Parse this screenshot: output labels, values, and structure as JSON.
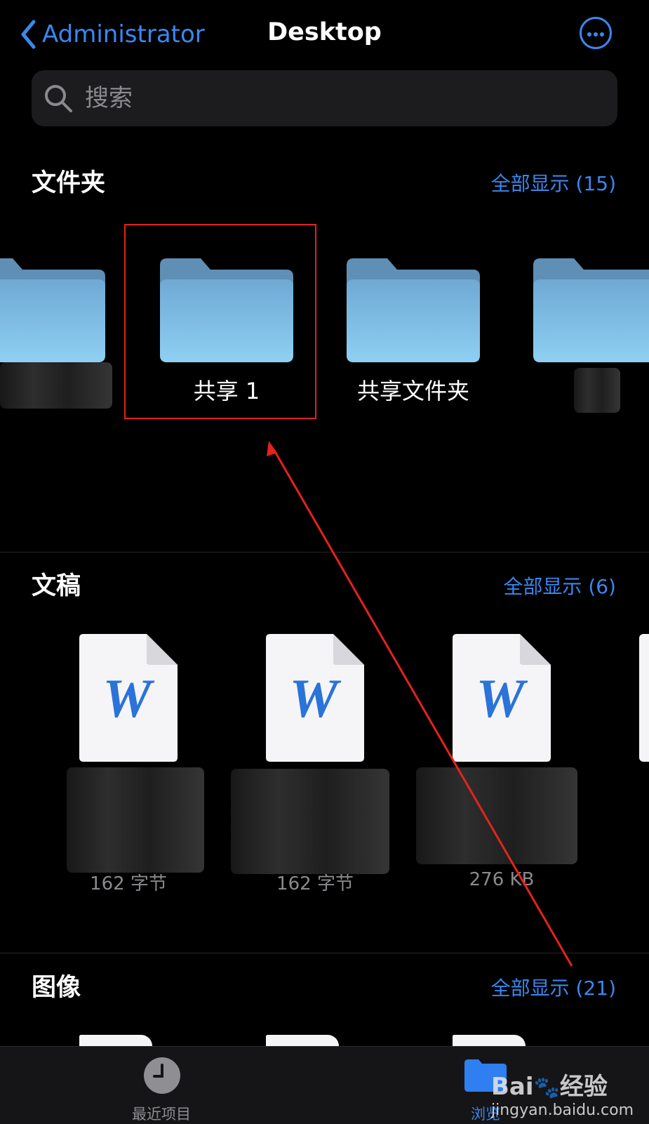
{
  "nav": {
    "back_label": "Administrator",
    "title": "Desktop"
  },
  "search": {
    "placeholder": "搜索"
  },
  "folders": {
    "title": "文件夹",
    "show_all": "全部显示 (15)",
    "items": [
      {
        "name": ""
      },
      {
        "name": "共享 1"
      },
      {
        "name": "共享文件夹"
      },
      {
        "name": ""
      }
    ]
  },
  "documents": {
    "title": "文稿",
    "show_all": "全部显示 (6)",
    "items": [
      {
        "icon": "word-icon",
        "glyph": "W",
        "size": "162 字节"
      },
      {
        "icon": "word-icon",
        "glyph": "W",
        "size": "162 字节"
      },
      {
        "icon": "word-icon",
        "glyph": "W",
        "size": "276 KB"
      }
    ]
  },
  "images": {
    "title": "图像",
    "show_all": "全部显示 (21)"
  },
  "tabbar": {
    "recent": {
      "label": "最近项目",
      "icon": "clock-icon"
    },
    "browse": {
      "label": "浏览",
      "icon": "folder-icon"
    }
  },
  "watermark": {
    "brand": "Bai",
    "brand2": "经验",
    "url": "jingyan.baidu.com"
  },
  "colors": {
    "accent": "#3a87f0",
    "highlight": "#e3231e",
    "folder_top": "#78b4de",
    "folder_bottom": "#8fd0f2"
  }
}
